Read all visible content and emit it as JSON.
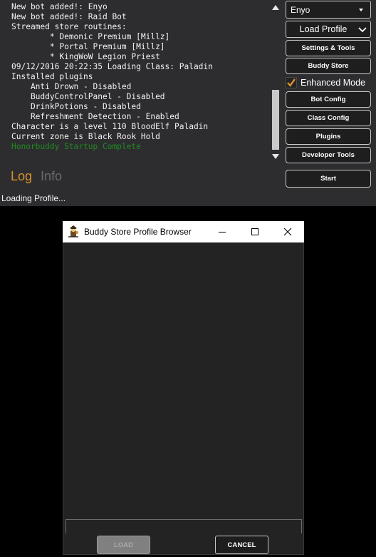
{
  "log": {
    "lines": [
      {
        "text": "New bot added!: Enyo",
        "color": "#f2f2f2"
      },
      {
        "text": "New bot added!: Raid Bot",
        "color": "#f2f2f2"
      },
      {
        "text": "Streamed store routines:",
        "color": "#f2f2f2"
      },
      {
        "text": "        * Demonic Premium [Millz]",
        "color": "#f2f2f2"
      },
      {
        "text": "        * Portal Premium [Millz]",
        "color": "#f2f2f2"
      },
      {
        "text": "        * KingWoW Legion Priest",
        "color": "#f2f2f2"
      },
      {
        "text": "09/12/2016 20:22:35 Loading Class: Paladin",
        "color": "#f2f2f2"
      },
      {
        "text": "Installed plugins",
        "color": "#f2f2f2"
      },
      {
        "text": "    Anti Drown - Disabled",
        "color": "#f2f2f2"
      },
      {
        "text": "    BuddyControlPanel - Disabled",
        "color": "#f2f2f2"
      },
      {
        "text": "    DrinkPotions - Disabled",
        "color": "#f2f2f2"
      },
      {
        "text": "    Refreshment Detection - Enabled",
        "color": "#f2f2f2"
      },
      {
        "text": "Character is a level 110 BloodElf Paladin",
        "color": "#f2f2f2"
      },
      {
        "text": "Current zone is Black Rook Hold",
        "color": "#f2f2f2"
      },
      {
        "text": "Honorbuddy Startup Complete",
        "color": "#1f8a1f"
      }
    ],
    "tabs": [
      {
        "label": "Log",
        "active": true,
        "color": "#d9902a"
      },
      {
        "label": "Info",
        "active": false,
        "color": "#6b6b6b"
      }
    ]
  },
  "status": {
    "text": "Loading Profile..."
  },
  "sidebar": {
    "bot_select": {
      "value": "Enyo",
      "icon": "caret-down-icon"
    },
    "profile_menu": {
      "label": "Load Profile",
      "icon": "chevron-down-icon"
    },
    "settings_label": "Settings & Tools",
    "store_label": "Buddy Store",
    "enhanced_mode": {
      "label": "Enhanced Mode",
      "checked": true,
      "check_color": "#d9902a"
    },
    "bot_config_label": "Bot Config",
    "class_config_label": "Class Config",
    "plugins_label": "Plugins",
    "developer_tools_label": "Developer Tools",
    "start_label": "Start"
  },
  "dialog": {
    "title": "Buddy Store Profile Browser",
    "load_label": "LOAD",
    "load_enabled": false,
    "cancel_label": "CANCEL"
  }
}
